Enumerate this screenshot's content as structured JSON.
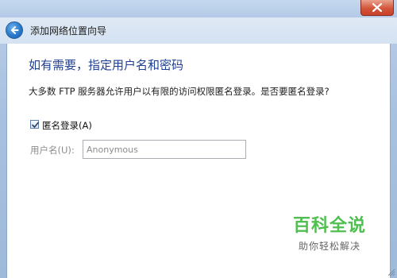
{
  "window": {
    "title": "添加网络位置向导",
    "close_icon": "close-icon",
    "back_icon": "back-arrow-icon"
  },
  "main": {
    "heading": "如有需要，指定用户名和密码",
    "description": "大多数 FTP 服务器允许用户以有限的访问权限匿名登录。是否要匿名登录?",
    "anonymous_checkbox": {
      "label": "匿名登录(A)",
      "checked": true
    },
    "username": {
      "label": "用户名(U):",
      "value": "Anonymous",
      "disabled": true
    }
  },
  "watermark": {
    "brand": "百科全说",
    "tagline": "助你轻松解决"
  },
  "colors": {
    "heading": "#1f3f92",
    "watermark": "#4fbf4f",
    "close_button": "#d4553b"
  }
}
